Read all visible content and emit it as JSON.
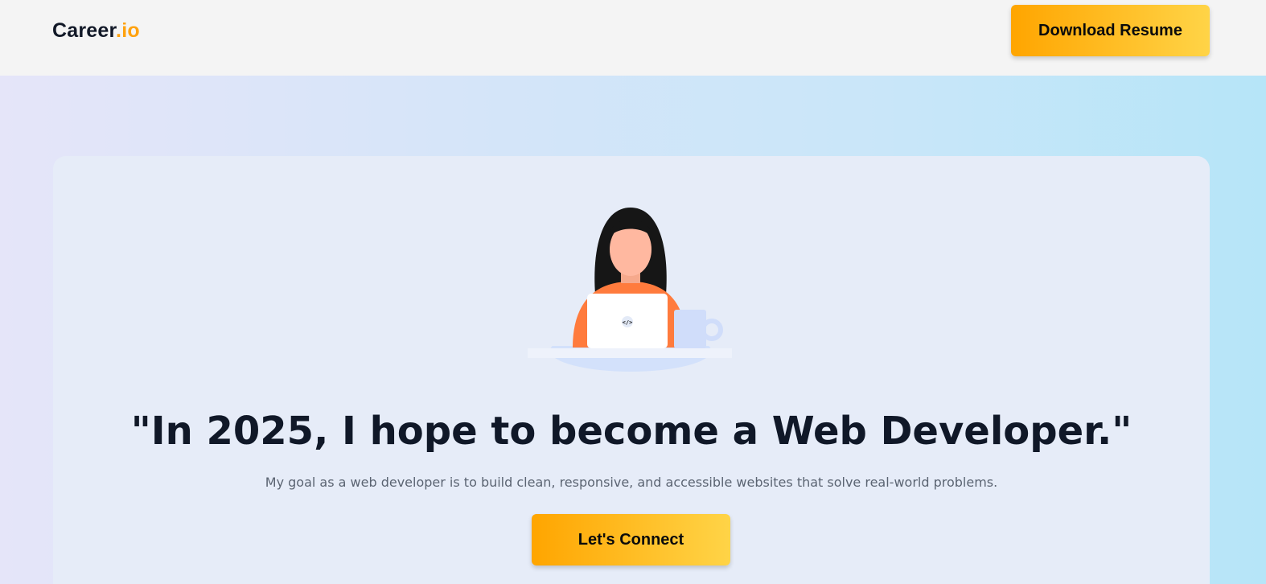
{
  "header": {
    "logo_main": "Career",
    "logo_accent": ".io",
    "download_label": "Download Resume"
  },
  "hero": {
    "illustration_icon": "developer-at-laptop-illustration",
    "laptop_badge": "</>",
    "headline": "\"In 2025, I hope to become a Web Developer.\"",
    "subtext": "My goal as a web developer is to build clean, responsive, and accessible websites that solve real-world problems.",
    "cta_label": "Let's Connect"
  },
  "colors": {
    "accent": "#ffa20f",
    "button_gradient_start": "#ffa500",
    "button_gradient_end": "#ffd447",
    "headline": "#101828",
    "card_bg": "#e6ecf8"
  }
}
